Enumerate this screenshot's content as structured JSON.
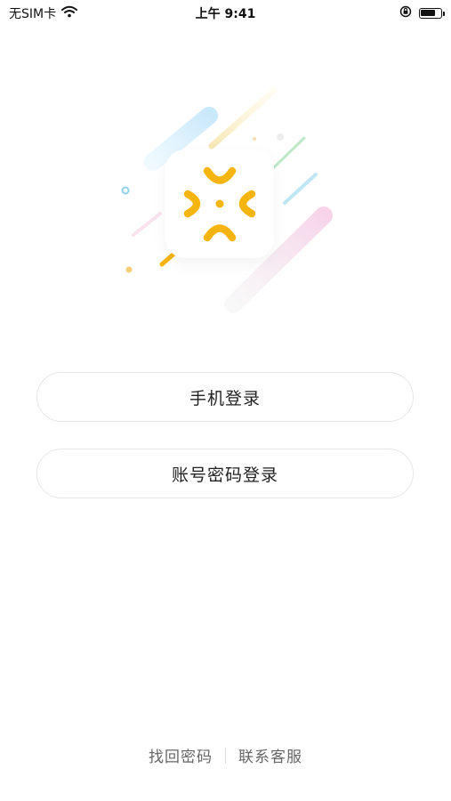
{
  "status_bar": {
    "carrier": "无SIM卡",
    "time": "上午 9:41",
    "battery_level": 0.8
  },
  "logo": {
    "brand_color": "#F5B40E"
  },
  "buttons": {
    "phone_login": "手机登录",
    "account_login": "账号密码登录"
  },
  "footer": {
    "recover_password": "找回密码",
    "contact_support": "联系客服"
  }
}
